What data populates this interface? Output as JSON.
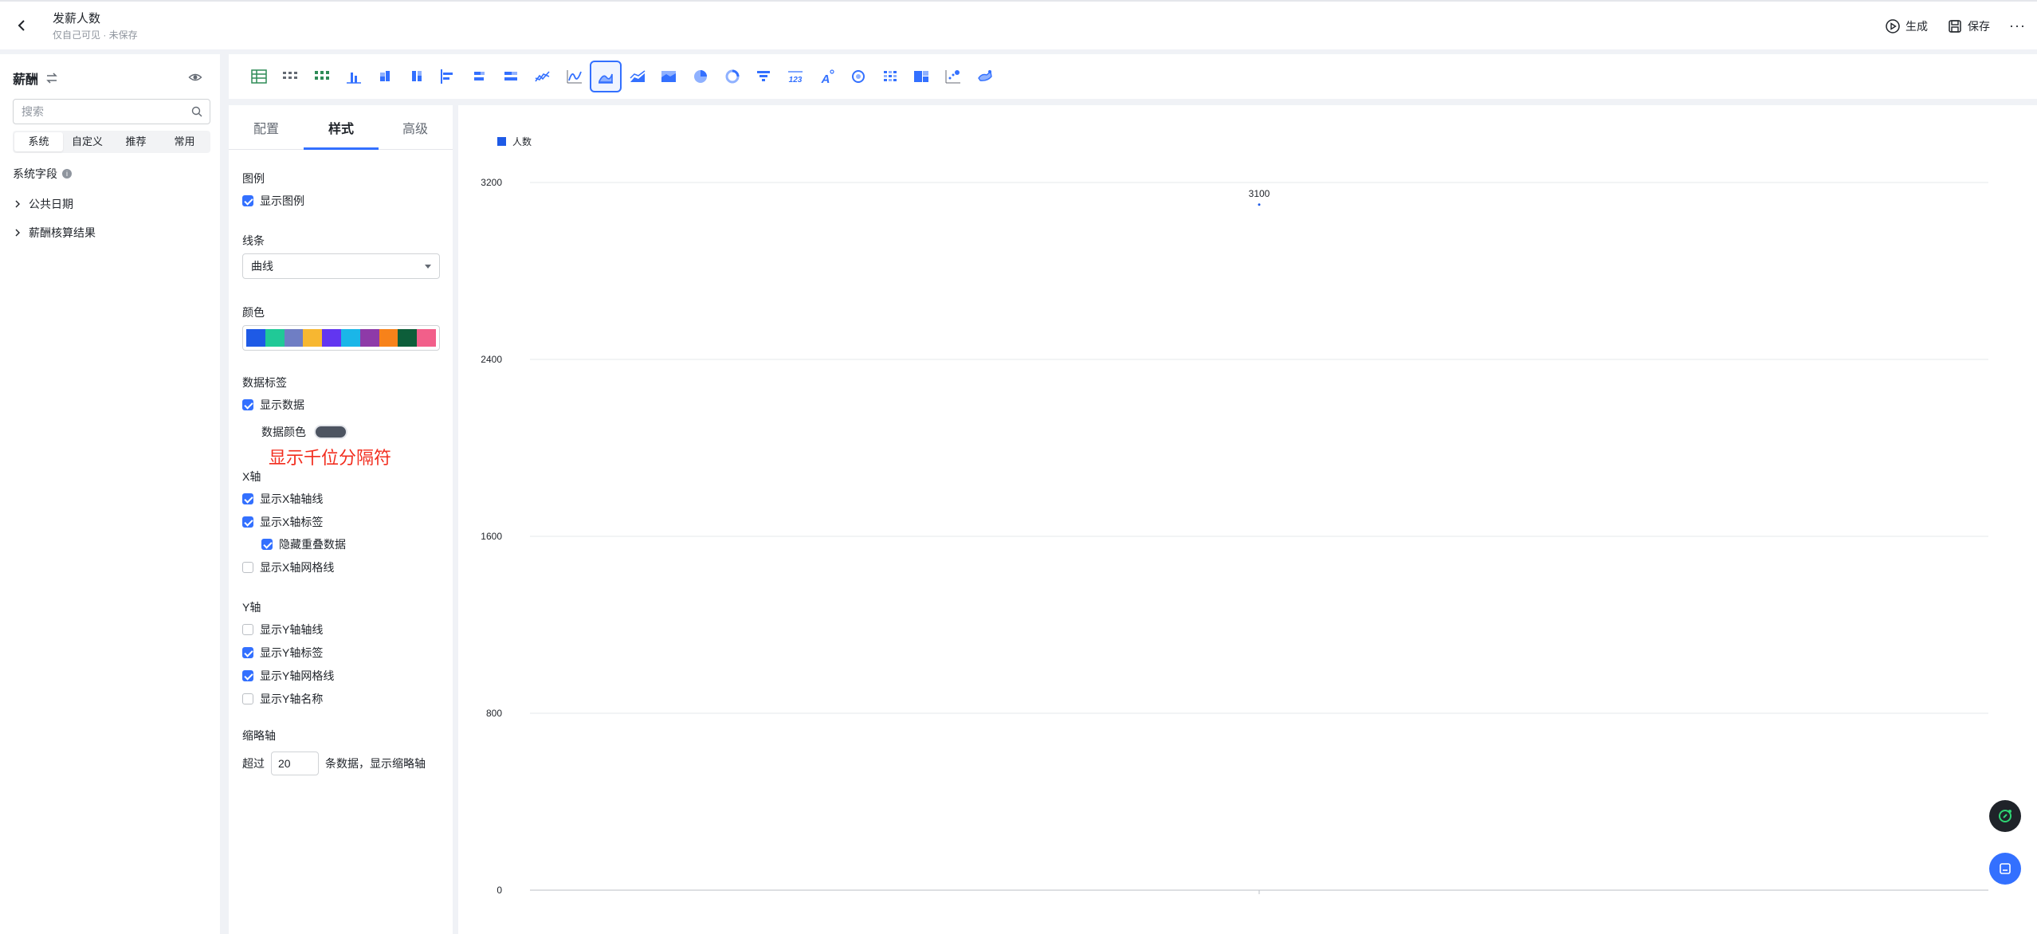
{
  "header": {
    "title": "发薪人数",
    "subtitle": "仅自己可见 · 未保存",
    "generate_label": "生成",
    "save_label": "保存",
    "more_label": "···"
  },
  "sidebar": {
    "title": "薪酬",
    "search_placeholder": "搜索",
    "tabs": [
      {
        "label": "系统",
        "active": true
      },
      {
        "label": "自定义",
        "active": false
      },
      {
        "label": "推荐",
        "active": false
      },
      {
        "label": "常用",
        "active": false
      }
    ],
    "section_title": "系统字段",
    "tree_items": [
      {
        "label": "公共日期"
      },
      {
        "label": "薪酬核算结果"
      }
    ]
  },
  "toolbar": {
    "active_index": 11,
    "icons": [
      "table-icon",
      "grid-table-icon",
      "pivot-table-icon",
      "column-chart-icon",
      "stacked-column-icon",
      "percent-column-icon",
      "bar-chart-icon",
      "stacked-bar-icon",
      "percent-bar-icon",
      "multi-line-icon",
      "line-chart-icon",
      "area-chart-icon",
      "stacked-area-icon",
      "percent-area-icon",
      "pie-chart-icon",
      "donut-chart-icon",
      "funnel-chart-icon",
      "number-card-icon",
      "text-card-icon",
      "gauge-icon",
      "heatmap-icon",
      "treemap-icon",
      "scatter-icon",
      "map-icon"
    ],
    "number_icon_text": "123",
    "text_icon_letter": "A"
  },
  "panel": {
    "tabs": [
      {
        "label": "配置",
        "active": false
      },
      {
        "label": "样式",
        "active": true
      },
      {
        "label": "高级",
        "active": false
      }
    ],
    "legend_heading": "图例",
    "show_legend_label": "显示图例",
    "show_legend": true,
    "line_heading": "线条",
    "line_value": "曲线",
    "color_heading": "颜色",
    "palette": [
      "#1e5ae6",
      "#20c997",
      "#6f7ec4",
      "#f7b731",
      "#6236f0",
      "#1ab6e8",
      "#8e3aa8",
      "#f7821a",
      "#0d5e3a",
      "#f25f8a"
    ],
    "data_label_heading": "数据标签",
    "show_data_label": "显示数据",
    "show_data": true,
    "data_color_label": "数据颜色",
    "data_color": "#4d5461",
    "annotation": "显示千位分隔符",
    "x_heading": "X轴",
    "x_options": [
      {
        "label": "显示X轴轴线",
        "checked": true,
        "indent": false
      },
      {
        "label": "显示X轴标签",
        "checked": true,
        "indent": false
      },
      {
        "label": "隐藏重叠数据",
        "checked": true,
        "indent": true
      },
      {
        "label": "显示X轴网格线",
        "checked": false,
        "indent": false
      }
    ],
    "y_heading": "Y轴",
    "y_options": [
      {
        "label": "显示Y轴轴线",
        "checked": false
      },
      {
        "label": "显示Y轴标签",
        "checked": true
      },
      {
        "label": "显示Y轴网格线",
        "checked": true
      },
      {
        "label": "显示Y轴名称",
        "checked": false
      }
    ],
    "thumb_heading": "缩略轴",
    "thumb_prefix": "超过",
    "thumb_value": "20",
    "thumb_suffix": "条数据，显示缩略轴"
  },
  "chart_data": {
    "type": "area",
    "legend": [
      "人数"
    ],
    "legend_placement": "top-left",
    "series": [
      {
        "name": "人数",
        "values": [
          3100
        ],
        "color": "#1e5ae6"
      }
    ],
    "categories": [
      ""
    ],
    "y_ticks": [
      0,
      800,
      1600,
      2400,
      3200
    ],
    "ylim": [
      0,
      3200
    ],
    "data_labels": [
      "3100"
    ],
    "grid": true
  },
  "colors": {
    "accent": "#3370ff",
    "annotation": "#f22d1e"
  }
}
